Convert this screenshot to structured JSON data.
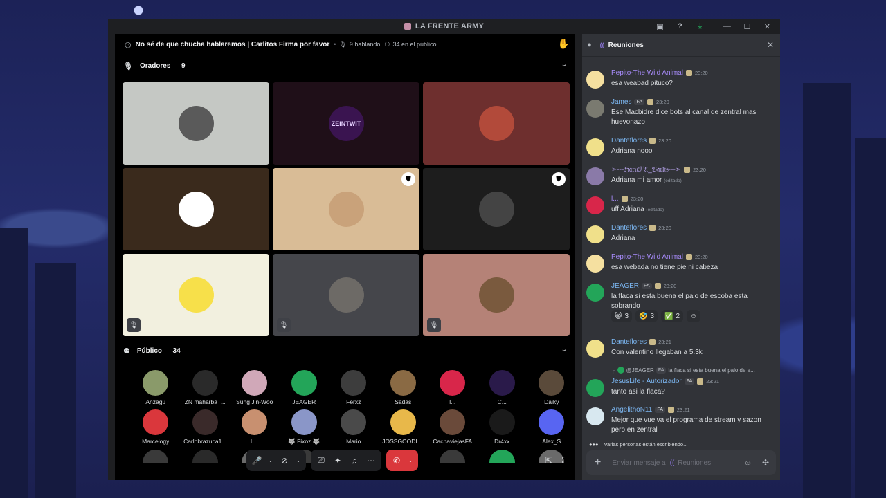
{
  "window": {
    "title": "LA FRENTE ARMY"
  },
  "stage": {
    "topic": "No sé de que chucha hablaremos | Carlitos Firma por favor",
    "speaking": "9 hablando",
    "audience_count": "34 en el público",
    "speakers_header": "Oradores — 9",
    "audience_header": "Público — 34",
    "tiles": [
      {
        "bg": "#c5c8c4",
        "av_bg": "#5a5a5a",
        "label": "",
        "mod": false,
        "muted": false
      },
      {
        "bg": "#1f0f18",
        "av_bg": "#3a1450",
        "label": "ZEINTWIT",
        "mod": false,
        "muted": false
      },
      {
        "bg": "#6e2f2e",
        "av_bg": "#b24a3a",
        "label": "",
        "mod": false,
        "muted": false
      },
      {
        "bg": "#3a2a1c",
        "av_bg": "#ffffff",
        "label": "",
        "mod": false,
        "muted": false
      },
      {
        "bg": "#d9bc96",
        "av_bg": "#c9a27a",
        "label": "",
        "mod": true,
        "muted": false
      },
      {
        "bg": "#1d1d1d",
        "av_bg": "#444444",
        "label": "",
        "mod": true,
        "muted": false
      },
      {
        "bg": "#f2f0df",
        "av_bg": "#f7e04a",
        "label": "",
        "mod": false,
        "muted": true
      },
      {
        "bg": "#45464b",
        "av_bg": "#6d6a66",
        "label": "",
        "mod": false,
        "muted": true
      },
      {
        "bg": "#b58277",
        "av_bg": "#7a5a3e",
        "label": "",
        "mod": false,
        "muted": true
      }
    ],
    "audience": [
      {
        "name": "Anzagu",
        "bg": "#8a9a6a"
      },
      {
        "name": "ZN maharba_...",
        "bg": "#2a2a2a"
      },
      {
        "name": "Sung Jin-Woo",
        "bg": "#d0a8b8"
      },
      {
        "name": "JEAGER",
        "bg": "#23a559"
      },
      {
        "name": "Ferxz",
        "bg": "#3d3d3d"
      },
      {
        "name": "Sadas",
        "bg": "#8a6a44"
      },
      {
        "name": "l...",
        "bg": "#d8264a"
      },
      {
        "name": "C...",
        "bg": "#2a1a4a"
      },
      {
        "name": "Daiky",
        "bg": "#5a4a3a"
      },
      {
        "name": "Marcelogy",
        "bg": "#da373c"
      },
      {
        "name": "Carlobrazuca1...",
        "bg": "#3a2a2a"
      },
      {
        "name": "L...",
        "bg": "#c89070"
      },
      {
        "name": "🐺 Fixoz 🐺",
        "bg": "#8a96c8"
      },
      {
        "name": "Mario",
        "bg": "#4a4a4a"
      },
      {
        "name": "JOSSGOODL...",
        "bg": "#e8b84a"
      },
      {
        "name": "CachaviejasFA",
        "bg": "#6a4a3a"
      },
      {
        "name": "Dr4xx",
        "bg": "#1a1a1a"
      },
      {
        "name": "Alex_S",
        "bg": "#5865f2"
      }
    ],
    "controls": {
      "mic": "🎤",
      "video_off": "⊘",
      "screen_share": "⎚",
      "activity": "✦",
      "soundboard": "♫",
      "more": "⋯",
      "hangup": "✆"
    }
  },
  "chat": {
    "channel": "Reuniones",
    "messages": [
      {
        "author": "Pepito-The Wild Animal",
        "color": "#a78bfa",
        "time": "23:20",
        "text": "esa weabad pituco?",
        "av_bg": "#f5e0a0",
        "tags": [],
        "edited": ""
      },
      {
        "author": "James",
        "color": "#7cb7f2",
        "time": "23:20",
        "text": "Ese Macbidre dice bots al canal de zentral mas huevonazo",
        "av_bg": "#7a7a70",
        "tags": [
          "FA"
        ],
        "edited": ""
      },
      {
        "author": "Danteflores",
        "color": "#7cb7f2",
        "time": "23:20",
        "text": "Adriana nooo",
        "av_bg": "#f0e08a",
        "tags": [],
        "edited": ""
      },
      {
        "author": "➣‐‐‐ℌ𝔞𝔯𝔲ℱ𝔄_𝔅𝔞𝔯𝔩𝔦𝔰‐‐‐➣",
        "color": "#b9a6ef",
        "time": "23:20",
        "text": "Adriana mi amor",
        "av_bg": "#8a7aa8",
        "tags": [],
        "edited": "(editado)"
      },
      {
        "author": "l...",
        "color": "#a78bfa",
        "time": "23:20",
        "text": "uff Adriana",
        "av_bg": "#d8264a",
        "tags": [],
        "edited": "(editado)"
      },
      {
        "author": "Danteflores",
        "color": "#7cb7f2",
        "time": "23:20",
        "text": "Adriana",
        "av_bg": "#f0e08a",
        "tags": [],
        "edited": ""
      },
      {
        "author": "Pepito-The Wild Animal",
        "color": "#a78bfa",
        "time": "23:20",
        "text": "esa webada no tiene pie ni cabeza",
        "av_bg": "#f5e0a0",
        "tags": [],
        "edited": ""
      },
      {
        "author": "JEAGER",
        "color": "#7cb7f2",
        "time": "23:20",
        "text": "la flaca si esta buena  el palo de escoba esta sobrando",
        "av_bg": "#23a559",
        "tags": [
          "FA"
        ],
        "edited": ""
      },
      {
        "author": "Danteflores",
        "color": "#7cb7f2",
        "time": "23:21",
        "text": "Con valentino llegaban a 5.3k",
        "av_bg": "#f0e08a",
        "tags": [],
        "edited": ""
      },
      {
        "author": "JesusLife - Autorizador",
        "color": "#7cb7f2",
        "time": "23:21",
        "text": "tanto asi la flaca?",
        "av_bg": "#23a559",
        "tags": [
          "FA"
        ],
        "edited": ""
      },
      {
        "author": "AngelithoN11",
        "color": "#7cb7f2",
        "time": "23:21",
        "text": "Mejor que vuelva el programa de stream y sazon pero en zentral",
        "av_bg": "#d8e8f0",
        "tags": [
          "FA"
        ],
        "edited": ""
      }
    ],
    "reactions": [
      {
        "emoji": "😸",
        "count": "3"
      },
      {
        "emoji": "🤣",
        "count": "3"
      },
      {
        "emoji": "✅",
        "count": "2"
      },
      {
        "emoji": "☺",
        "count": ""
      }
    ],
    "reply": {
      "author": "@JEAGER",
      "tag": "FA",
      "text": "la flaca si esta buena  el palo de e..."
    },
    "typing": "Varias personas están escribiendo...",
    "typing_bold": "Varias personas",
    "composer_placeholder": "Enviar mensaje a",
    "composer_channel": "Reuniones"
  }
}
